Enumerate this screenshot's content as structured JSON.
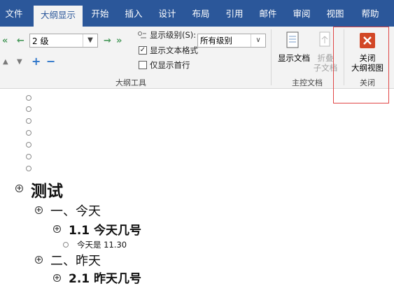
{
  "tabs": [
    {
      "label": "文件",
      "active": false
    },
    {
      "label": "大纲显示",
      "active": true
    },
    {
      "label": "开始",
      "active": false
    },
    {
      "label": "插入",
      "active": false
    },
    {
      "label": "设计",
      "active": false
    },
    {
      "label": "布局",
      "active": false
    },
    {
      "label": "引用",
      "active": false
    },
    {
      "label": "邮件",
      "active": false
    },
    {
      "label": "审阅",
      "active": false
    },
    {
      "label": "视图",
      "active": false
    },
    {
      "label": "帮助",
      "active": false
    }
  ],
  "outline_tools": {
    "level_value": "2 级",
    "show_level_label": "显示级别(S):",
    "show_level_value": "所有级别",
    "show_format_label": "显示文本格式",
    "show_format_checked": true,
    "first_line_label": "仅显示首行",
    "first_line_checked": false,
    "group_label": "大纲工具"
  },
  "master_doc": {
    "show_doc_label": "显示文档",
    "collapse_label_1": "折叠",
    "collapse_label_2": "子文档",
    "group_label": "主控文档"
  },
  "close_group": {
    "close_label_1": "关闭",
    "close_label_2": "大纲视图",
    "group_label": "关闭"
  },
  "document": {
    "heading1": "测试",
    "item1": "一、今天",
    "item1_sub": "1.1 今天几号",
    "item1_body": "今天是 11.30",
    "item2": "二、昨天",
    "item2_sub": "2.1 昨天几号"
  },
  "colors": {
    "tab_bar": "#2b579a",
    "ribbon": "#f3f3f3",
    "close_icon": "#d24726",
    "highlight_border": "#e04646"
  }
}
